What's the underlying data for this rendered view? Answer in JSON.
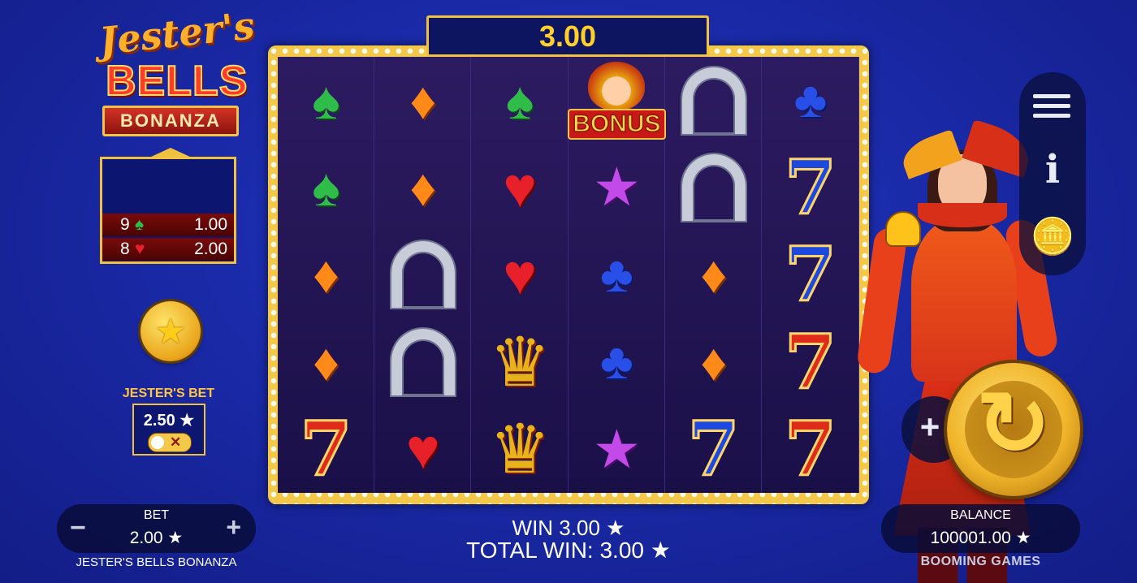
{
  "logo": {
    "line1": "Jester's",
    "line2": "BELLS",
    "line3": "BONANZA"
  },
  "win_banner": {
    "value": "3.00"
  },
  "paytable": {
    "rows": [
      {
        "count": "9",
        "symbol": "♠",
        "symbol_color": "#2fbd4a",
        "value": "1.00"
      },
      {
        "count": "8",
        "symbol": "♥",
        "symbol_color": "#e8202a",
        "value": "2.00"
      }
    ]
  },
  "feature_coin": {
    "icon": "★"
  },
  "jesters_bet": {
    "label": "JESTER'S BET",
    "value": "2.50 ★",
    "toggle_state": "off",
    "toggle_icon": "✕"
  },
  "reels": [
    [
      "spade",
      "spade",
      "diamond",
      "diamond",
      "seven-red"
    ],
    [
      "diamond",
      "diamond",
      "horseshoe",
      "horseshoe",
      "heart"
    ],
    [
      "spade",
      "heart",
      "heart",
      "crown",
      "crown"
    ],
    [
      "bonus",
      "star",
      "club",
      "club",
      "star"
    ],
    [
      "horseshoe",
      "horseshoe",
      "diamond",
      "diamond",
      "seven-blue"
    ],
    [
      "club",
      "seven-blue",
      "seven-blue",
      "seven-red",
      "seven-red"
    ]
  ],
  "bonus_label": "BONUS",
  "menu": {
    "items": [
      "hamburger-menu-icon",
      "info-icon",
      "coins-icon"
    ],
    "info_glyph": "i",
    "coins_glyph": "🪙"
  },
  "controls": {
    "plus": "+",
    "spin_icon": "↻"
  },
  "bet": {
    "label": "BET",
    "value": "2.00 ★",
    "minus": "−",
    "plus": "+"
  },
  "game_name": "JESTER'S BELLS BONANZA",
  "balance": {
    "label": "BALANCE",
    "value": "100001.00 ★"
  },
  "studio": "BOOMING GAMES",
  "win": {
    "line": "WIN 3.00 ★",
    "total": "TOTAL WIN: 3.00 ★"
  }
}
